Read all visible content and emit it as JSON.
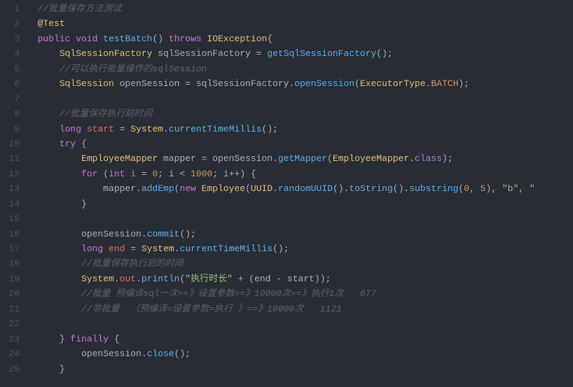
{
  "lines": [
    {
      "n": 1,
      "segs": [
        {
          "cls": "c-plain",
          "t": "  "
        },
        {
          "cls": "c-comment",
          "t": "//批量保存方法测试"
        }
      ]
    },
    {
      "n": 2,
      "segs": [
        {
          "cls": "c-plain",
          "t": "  "
        },
        {
          "cls": "c-anno",
          "t": "@Test"
        }
      ]
    },
    {
      "n": 3,
      "segs": [
        {
          "cls": "c-plain",
          "t": "  "
        },
        {
          "cls": "c-keyword",
          "t": "public"
        },
        {
          "cls": "c-plain",
          "t": " "
        },
        {
          "cls": "c-keyword",
          "t": "void"
        },
        {
          "cls": "c-plain",
          "t": " "
        },
        {
          "cls": "c-method",
          "t": "testBatch"
        },
        {
          "cls": "c-plain",
          "t": "() "
        },
        {
          "cls": "c-keyword",
          "t": "throws"
        },
        {
          "cls": "c-plain",
          "t": " "
        },
        {
          "cls": "c-type",
          "t": "IOException"
        },
        {
          "cls": "c-plain",
          "t": "{"
        }
      ]
    },
    {
      "n": 4,
      "segs": [
        {
          "cls": "c-plain",
          "t": "      "
        },
        {
          "cls": "c-type",
          "t": "SqlSessionFactory"
        },
        {
          "cls": "c-plain",
          "t": " sqlSessionFactory = "
        },
        {
          "cls": "c-method",
          "t": "getSqlSessionFactory"
        },
        {
          "cls": "c-plain",
          "t": "();"
        }
      ]
    },
    {
      "n": 5,
      "segs": [
        {
          "cls": "c-plain",
          "t": "      "
        },
        {
          "cls": "c-comment",
          "t": "//可以执行批量操作的sqlSession"
        }
      ]
    },
    {
      "n": 6,
      "segs": [
        {
          "cls": "c-plain",
          "t": "      "
        },
        {
          "cls": "c-type",
          "t": "SqlSession"
        },
        {
          "cls": "c-plain",
          "t": " openSession = sqlSessionFactory."
        },
        {
          "cls": "c-method",
          "t": "openSession"
        },
        {
          "cls": "c-plain",
          "t": "("
        },
        {
          "cls": "c-type",
          "t": "ExecutorType"
        },
        {
          "cls": "c-plain",
          "t": "."
        },
        {
          "cls": "c-const",
          "t": "BATCH"
        },
        {
          "cls": "c-plain",
          "t": ");"
        }
      ]
    },
    {
      "n": 7,
      "segs": [
        {
          "cls": "c-plain",
          "t": " "
        }
      ]
    },
    {
      "n": 8,
      "segs": [
        {
          "cls": "c-plain",
          "t": "      "
        },
        {
          "cls": "c-comment",
          "t": "//批量保存执行前时间"
        }
      ]
    },
    {
      "n": 9,
      "segs": [
        {
          "cls": "c-plain",
          "t": "      "
        },
        {
          "cls": "c-keyword",
          "t": "long"
        },
        {
          "cls": "c-plain",
          "t": " "
        },
        {
          "cls": "c-ident",
          "t": "start"
        },
        {
          "cls": "c-plain",
          "t": " = "
        },
        {
          "cls": "c-type",
          "t": "System"
        },
        {
          "cls": "c-plain",
          "t": "."
        },
        {
          "cls": "c-method",
          "t": "currentTimeMillis"
        },
        {
          "cls": "c-plain",
          "t": "();"
        }
      ]
    },
    {
      "n": 10,
      "segs": [
        {
          "cls": "c-plain",
          "t": "      "
        },
        {
          "cls": "c-keyword",
          "t": "try"
        },
        {
          "cls": "c-plain",
          "t": " {"
        }
      ]
    },
    {
      "n": 11,
      "segs": [
        {
          "cls": "c-plain",
          "t": "          "
        },
        {
          "cls": "c-type",
          "t": "EmployeeMapper"
        },
        {
          "cls": "c-plain",
          "t": " mapper = openSession."
        },
        {
          "cls": "c-method",
          "t": "getMapper"
        },
        {
          "cls": "c-plain",
          "t": "("
        },
        {
          "cls": "c-type",
          "t": "EmployeeMapper"
        },
        {
          "cls": "c-plain",
          "t": "."
        },
        {
          "cls": "c-keyword",
          "t": "class"
        },
        {
          "cls": "c-plain",
          "t": ");"
        }
      ]
    },
    {
      "n": 12,
      "segs": [
        {
          "cls": "c-plain",
          "t": "          "
        },
        {
          "cls": "c-keyword",
          "t": "for"
        },
        {
          "cls": "c-plain",
          "t": " ("
        },
        {
          "cls": "c-keyword",
          "t": "int"
        },
        {
          "cls": "c-plain",
          "t": " "
        },
        {
          "cls": "c-ident",
          "t": "i"
        },
        {
          "cls": "c-plain",
          "t": " = "
        },
        {
          "cls": "c-num",
          "t": "0"
        },
        {
          "cls": "c-plain",
          "t": "; i < "
        },
        {
          "cls": "c-num",
          "t": "1000"
        },
        {
          "cls": "c-plain",
          "t": "; i++) {"
        }
      ]
    },
    {
      "n": 13,
      "segs": [
        {
          "cls": "c-plain",
          "t": "              mapper."
        },
        {
          "cls": "c-method",
          "t": "addEmp"
        },
        {
          "cls": "c-plain",
          "t": "("
        },
        {
          "cls": "c-keyword",
          "t": "new"
        },
        {
          "cls": "c-plain",
          "t": " "
        },
        {
          "cls": "c-type",
          "t": "Employee"
        },
        {
          "cls": "c-plain",
          "t": "("
        },
        {
          "cls": "c-type",
          "t": "UUID"
        },
        {
          "cls": "c-plain",
          "t": "."
        },
        {
          "cls": "c-method",
          "t": "randomUUID"
        },
        {
          "cls": "c-plain",
          "t": "()."
        },
        {
          "cls": "c-method",
          "t": "toString"
        },
        {
          "cls": "c-plain",
          "t": "()."
        },
        {
          "cls": "c-method",
          "t": "substring"
        },
        {
          "cls": "c-plain",
          "t": "("
        },
        {
          "cls": "c-num",
          "t": "0"
        },
        {
          "cls": "c-plain",
          "t": ", "
        },
        {
          "cls": "c-num",
          "t": "5"
        },
        {
          "cls": "c-plain",
          "t": "), "
        },
        {
          "cls": "c-string",
          "t": "\"b\""
        },
        {
          "cls": "c-plain",
          "t": ", "
        },
        {
          "cls": "c-string",
          "t": "\""
        }
      ]
    },
    {
      "n": 14,
      "segs": [
        {
          "cls": "c-plain",
          "t": "          }"
        }
      ]
    },
    {
      "n": 15,
      "segs": [
        {
          "cls": "c-plain",
          "t": " "
        }
      ]
    },
    {
      "n": 16,
      "segs": [
        {
          "cls": "c-plain",
          "t": "          openSession."
        },
        {
          "cls": "c-method",
          "t": "commit"
        },
        {
          "cls": "c-plain",
          "t": "();"
        }
      ]
    },
    {
      "n": 17,
      "segs": [
        {
          "cls": "c-plain",
          "t": "          "
        },
        {
          "cls": "c-keyword",
          "t": "long"
        },
        {
          "cls": "c-plain",
          "t": " "
        },
        {
          "cls": "c-ident",
          "t": "end"
        },
        {
          "cls": "c-plain",
          "t": " = "
        },
        {
          "cls": "c-type",
          "t": "System"
        },
        {
          "cls": "c-plain",
          "t": "."
        },
        {
          "cls": "c-method",
          "t": "currentTimeMillis"
        },
        {
          "cls": "c-plain",
          "t": "();"
        }
      ]
    },
    {
      "n": 18,
      "segs": [
        {
          "cls": "c-plain",
          "t": "          "
        },
        {
          "cls": "c-comment",
          "t": "//批量保存执行后的时间"
        }
      ]
    },
    {
      "n": 19,
      "segs": [
        {
          "cls": "c-plain",
          "t": "          "
        },
        {
          "cls": "c-type",
          "t": "System"
        },
        {
          "cls": "c-plain",
          "t": "."
        },
        {
          "cls": "c-ident",
          "t": "out"
        },
        {
          "cls": "c-plain",
          "t": "."
        },
        {
          "cls": "c-method",
          "t": "println"
        },
        {
          "cls": "c-plain",
          "t": "("
        },
        {
          "cls": "c-string",
          "t": "\"执行时长\""
        },
        {
          "cls": "c-plain",
          "t": " + (end - start));"
        }
      ]
    },
    {
      "n": 20,
      "segs": [
        {
          "cls": "c-plain",
          "t": "          "
        },
        {
          "cls": "c-comment",
          "t": "//批量 预编译sql一次==》设置参数==》10000次==》执行1次   677"
        }
      ]
    },
    {
      "n": 21,
      "segs": [
        {
          "cls": "c-plain",
          "t": "          "
        },
        {
          "cls": "c-comment",
          "t": "//非批量  （预编译=设置参数=执行 ）==》10000次   1121"
        }
      ]
    },
    {
      "n": 22,
      "segs": [
        {
          "cls": "c-plain",
          "t": " "
        }
      ]
    },
    {
      "n": 23,
      "segs": [
        {
          "cls": "c-plain",
          "t": "      } "
        },
        {
          "cls": "c-keyword",
          "t": "finally"
        },
        {
          "cls": "c-plain",
          "t": " {"
        }
      ]
    },
    {
      "n": 24,
      "segs": [
        {
          "cls": "c-plain",
          "t": "          openSession."
        },
        {
          "cls": "c-method",
          "t": "close"
        },
        {
          "cls": "c-plain",
          "t": "();"
        }
      ]
    },
    {
      "n": 25,
      "segs": [
        {
          "cls": "c-plain",
          "t": "      }"
        }
      ]
    }
  ]
}
